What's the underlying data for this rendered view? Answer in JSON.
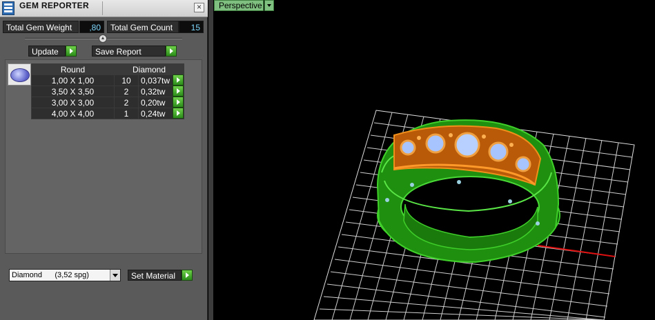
{
  "window": {
    "title": "GEM REPORTER",
    "close_glyph": "×"
  },
  "stats": {
    "total_weight_label": "Total Gem Weight",
    "total_weight_value": ",80",
    "total_count_label": "Total Gem Count",
    "total_count_value": "15"
  },
  "actions": {
    "update_label": "Update",
    "save_report_label": "Save Report"
  },
  "table": {
    "headers": {
      "shape": "Round",
      "material": "Diamond"
    },
    "rows": [
      {
        "size": "1,00 X 1,00",
        "count": "10",
        "weight": "0,037tw"
      },
      {
        "size": "3,50 X 3,50",
        "count": "2",
        "weight": "0,32tw"
      },
      {
        "size": "3,00 X 3,00",
        "count": "2",
        "weight": "0,20tw"
      },
      {
        "size": "4,00 X 4,00",
        "count": "1",
        "weight": "0,24tw"
      }
    ]
  },
  "material": {
    "selected": "Diamond      (3,52 spg)",
    "set_label": "Set Material"
  },
  "viewport": {
    "mode_label": "Perspective"
  },
  "icons": [
    "gem-reporter-app-icon",
    "close-icon",
    "slider-knob-icon",
    "play-arrow-icon",
    "round-gem-icon",
    "dropdown-arrow-icon"
  ],
  "colors": {
    "ring_body": "#1f8f0f",
    "prongs": "#e07a10",
    "stones": "#a8c4ff",
    "grid": "#d8d8d8",
    "x_axis": "#e01010",
    "z_axis": "#10b0c0",
    "go_button": "#3aa421"
  }
}
